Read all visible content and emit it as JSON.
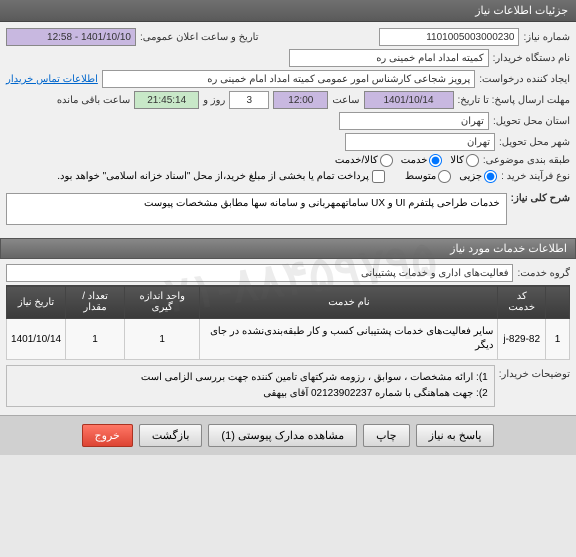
{
  "header": {
    "title": "جزئیات اطلاعات نیاز"
  },
  "form": {
    "need_number_label": "شماره نیاز:",
    "need_number": "1101005003000230",
    "announce_date_label": "تاریخ و ساعت اعلان عمومی:",
    "announce_date": "1401/10/10 - 12:58",
    "buyer_name_label": "نام دستگاه خریدار:",
    "buyer_name": "کمیته امداد امام خمینی ره",
    "requester_label": "ایجاد کننده درخواست:",
    "requester": "پرویز شجاعی کارشناس امور عمومی کمیته امداد امام خمینی ره",
    "contact_link": "اطلاعات تماس خریدار",
    "deadline_label": "مهلت ارسال پاسخ: تا تاریخ:",
    "deadline_date": "1401/10/14",
    "time_label": "ساعت",
    "deadline_time": "12:00",
    "days_remaining": "3",
    "days_label": "روز و",
    "time_remaining": "21:45:14",
    "remaining_label": "ساعت باقی مانده",
    "province_label": "استان محل تحویل:",
    "province": "تهران",
    "city_label": "شهر محل تحویل:",
    "city": "تهران",
    "classification_label": "طبقه بندی موضوعی:",
    "radio_goods": "کالا",
    "radio_service": "خدمت",
    "radio_both": "کالا/خدمت",
    "purchase_type_label": "نوع فرآیند خرید :",
    "radio_small": "جزیی",
    "radio_medium": "متوسط",
    "checkbox_text": "پرداخت تمام یا بخشی از مبلغ خرید،از محل \"اسناد خزانه اسلامی\" خواهد بود."
  },
  "description": {
    "title_label": "شرح کلی نیاز:",
    "text": "خدمات طراحی پلتفرم UI و UX ساماتهمهربانی و سامانه سها مطابق مشخصات پیوست"
  },
  "services_section": {
    "header": "اطلاعات خدمات مورد نیاز",
    "group_label": "گروه خدمت:",
    "group_value": "فعالیت‌های اداری و خدمات پشتیبانی"
  },
  "table": {
    "headers": [
      "",
      "کد خدمت",
      "نام خدمت",
      "واحد اندازه گیری",
      "تعداد / مقدار",
      "تاریخ نیاز"
    ],
    "rows": [
      {
        "num": "1",
        "code": "829-82-j",
        "name": "سایر فعالیت‌های خدمات پشتیبانی کسب و کار طبقه‌بندی‌نشده در جای دیگر",
        "unit": "1",
        "qty": "1",
        "date": "1401/10/14"
      }
    ]
  },
  "notes": {
    "label": "توضیحات خریدار:",
    "line1": "1): ارائه مشخصات ، سوابق ، رزومه شرکتهای تامین کننده جهت بررسی الزامی است",
    "line2": "2): جهت هماهنگی با شماره 02123902237 آقای بیهقی"
  },
  "buttons": {
    "respond": "پاسخ به نیاز",
    "print": "چاپ",
    "attachments": "مشاهده مدارک پیوستی (1)",
    "back": "بازگشت",
    "exit": "خروج"
  },
  "watermark": "۰۲۱-۸۸۴۵۹۷۹۵"
}
